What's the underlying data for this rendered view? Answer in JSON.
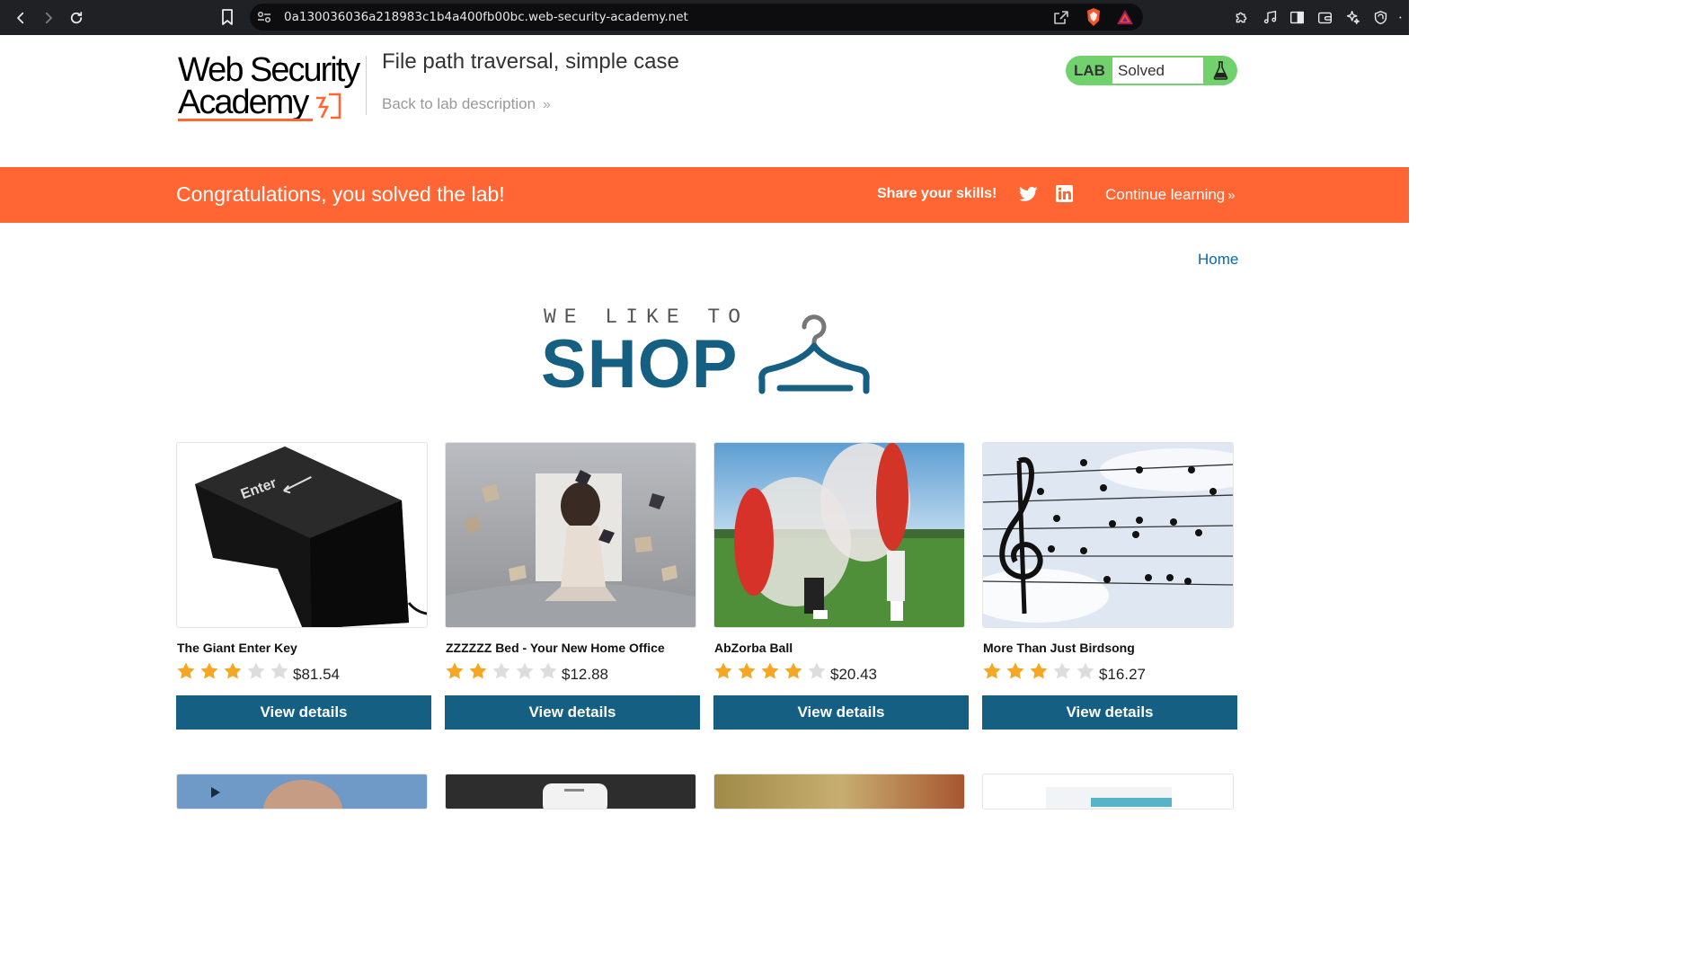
{
  "browser": {
    "url": "0a130036036a218983c1b4a400fb00bc.web-security-academy.net"
  },
  "lab_header": {
    "logo_line1": "Web Security",
    "logo_line2": "Academy",
    "title": "File path traversal, simple case",
    "back_link": "Back to lab description",
    "status_label": "LAB",
    "status_value": "Solved"
  },
  "banner": {
    "message": "Congratulations, you solved the lab!",
    "share_label": "Share your skills!",
    "continue_label": "Continue learning"
  },
  "nav": {
    "home": "Home"
  },
  "shop_logo": {
    "tagline": "WE LIKE TO",
    "word": "SHOP"
  },
  "products": [
    {
      "name": "The Giant Enter Key",
      "price": "$81.54",
      "rating": 3,
      "button": "View details"
    },
    {
      "name": "ZZZZZZ Bed - Your New Home Office",
      "price": "$12.88",
      "rating": 2,
      "button": "View details"
    },
    {
      "name": "AbZorba Ball",
      "price": "$20.43",
      "rating": 4,
      "button": "View details"
    },
    {
      "name": "More Than Just Birdsong",
      "price": "$16.27",
      "rating": 3,
      "button": "View details"
    }
  ],
  "colors": {
    "accent_orange": "#ff6633",
    "brand_blue": "#155f82",
    "solved_green": "#70d16d",
    "star_gold": "#f5a623",
    "star_grey": "#dddddd"
  }
}
